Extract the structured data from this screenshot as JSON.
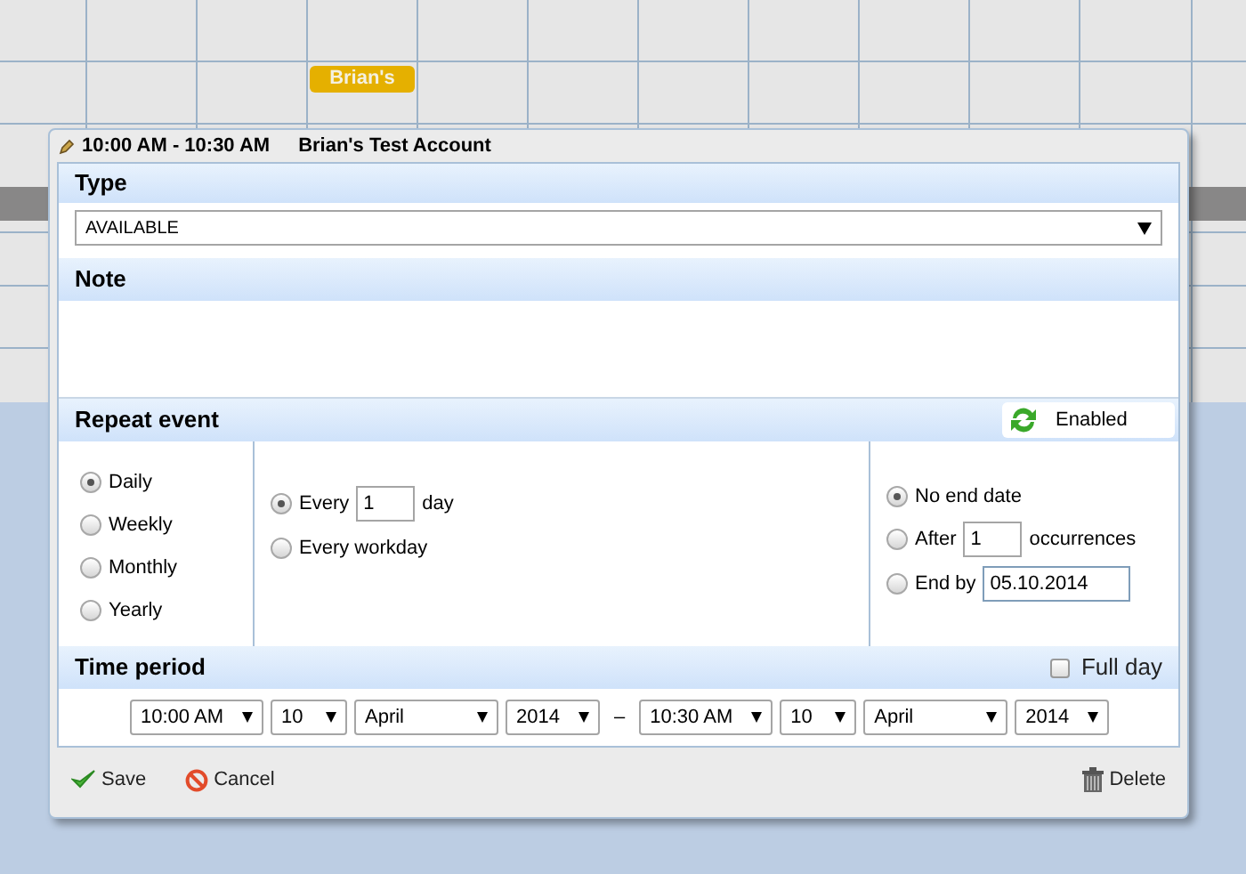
{
  "calendar": {
    "event_chip": "Brian's"
  },
  "dialog": {
    "time_range": "10:00 AM - 10:30 AM",
    "account": "Brian's Test Account",
    "type": {
      "title": "Type",
      "value": "AVAILABLE"
    },
    "note": {
      "title": "Note"
    },
    "repeat": {
      "title": "Repeat event",
      "toggle": {
        "label": "Enabled",
        "on": true
      },
      "frequencies": [
        {
          "label": "Daily",
          "selected": true
        },
        {
          "label": "Weekly",
          "selected": false
        },
        {
          "label": "Monthly",
          "selected": false
        },
        {
          "label": "Yearly",
          "selected": false
        }
      ],
      "daily_options": [
        {
          "kind": "count",
          "label": "Every",
          "value": "1",
          "unit": "day",
          "selected": true
        },
        {
          "kind": "plain",
          "label": "Every workday",
          "selected": false
        }
      ],
      "end_options": [
        {
          "kind": "plain",
          "label": "No end date",
          "selected": true
        },
        {
          "kind": "count",
          "label": "After",
          "value": "1",
          "unit": "occurrences",
          "selected": false
        },
        {
          "kind": "date",
          "label": "End by",
          "value": "05.10.2014",
          "selected": false
        }
      ]
    },
    "time_period": {
      "title": "Time period",
      "full_day": {
        "label": "Full day",
        "checked": false
      },
      "start": [
        "10:00 AM",
        "10",
        "April",
        "2014"
      ],
      "separator": "–",
      "end": [
        "10:30 AM",
        "10",
        "April",
        "2014"
      ]
    },
    "buttons": [
      {
        "kind": "save",
        "label": "Save"
      },
      {
        "kind": "cancel",
        "label": "Cancel"
      },
      {
        "kind": "delete",
        "label": "Delete"
      }
    ]
  }
}
